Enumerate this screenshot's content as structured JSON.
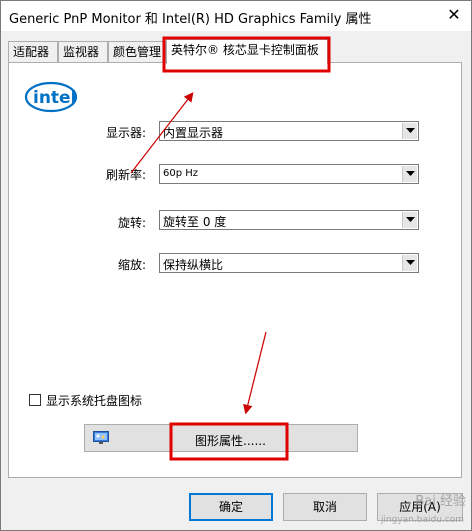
{
  "window": {
    "title": "Generic PnP Monitor 和 Intel(R) HD Graphics Family 属性",
    "close_glyph": "✕"
  },
  "tabs": [
    {
      "label": "适配器",
      "active": false
    },
    {
      "label": "监视器",
      "active": false
    },
    {
      "label": "颜色管理",
      "active": false
    },
    {
      "label": "英特尔® 核芯显卡控制面板",
      "active": true
    }
  ],
  "logo": {
    "text": "intel",
    "icon": "intel-logo",
    "color": "#0071c5"
  },
  "fields": {
    "display": {
      "label": "显示器:",
      "value": "内置显示器"
    },
    "refresh": {
      "label": "刷新率:",
      "value": "60p Hz"
    },
    "rotation": {
      "label": "旋转:",
      "value": "旋转至 0 度"
    },
    "scaling": {
      "label": "缩放:",
      "value": "保持纵横比"
    }
  },
  "tray_checkbox": {
    "label": "显示系统托盘图标",
    "checked": false
  },
  "graphics_button": {
    "label": "图形属性......",
    "icon": "graphics-properties-icon"
  },
  "footer": {
    "ok": "确定",
    "cancel": "取消",
    "apply": "应用(A)"
  },
  "watermark": {
    "text": "Bai 经验",
    "sub": "jingyan.baidu.com"
  },
  "colors": {
    "highlight_box": "#e00000",
    "arrow": "#cc0000",
    "default_button_border": "#0078d7"
  }
}
